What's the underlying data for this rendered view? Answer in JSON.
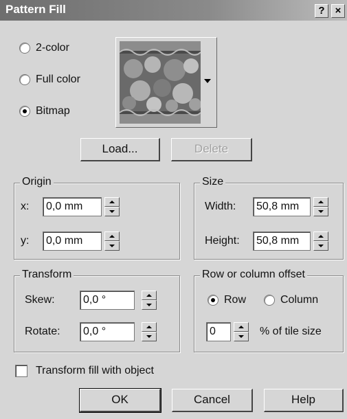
{
  "window": {
    "title": "Pattern Fill",
    "help_button": "?",
    "close_button": "×"
  },
  "fill_type": {
    "options": [
      "2-color",
      "Full color",
      "Bitmap"
    ],
    "selected": "Bitmap"
  },
  "buttons": {
    "load": "Load...",
    "delete": "Delete",
    "ok": "OK",
    "cancel": "Cancel",
    "help": "Help"
  },
  "origin": {
    "title": "Origin",
    "x_label": "x:",
    "x_value": "0,0 mm",
    "y_label": "y:",
    "y_value": "0,0 mm"
  },
  "size": {
    "title": "Size",
    "width_label": "Width:",
    "width_value": "50,8 mm",
    "height_label": "Height:",
    "height_value": "50,8 mm"
  },
  "transform": {
    "title": "Transform",
    "skew_label": "Skew:",
    "skew_value": "0,0 °",
    "rotate_label": "Rotate:",
    "rotate_value": "0,0 °"
  },
  "offset": {
    "title": "Row or column offset",
    "row_label": "Row",
    "column_label": "Column",
    "selected": "Row",
    "value": "0",
    "suffix": "% of tile size"
  },
  "transform_fill_with_object": {
    "label": "Transform fill with object",
    "checked": false
  },
  "icons": [
    "help-icon",
    "close-icon",
    "dropdown-arrow-icon",
    "spin-up-icon",
    "spin-down-icon"
  ]
}
